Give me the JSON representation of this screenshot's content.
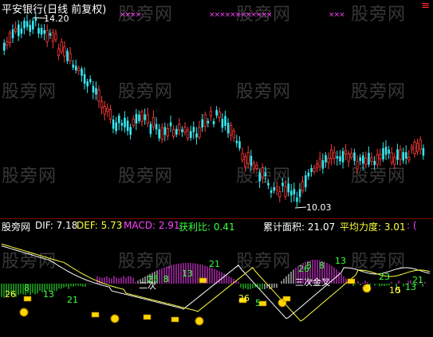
{
  "header": {
    "title": "平安银行(日线 前复权)",
    "top_right_mark": "≡",
    "top_marks_1": "××××",
    "top_marks_2": "××××××××××××",
    "top_marks_3": "×××"
  },
  "price_panel": {
    "high_label": "14.20",
    "low_label": "10.03",
    "colors": {
      "up": "#ff3a3a",
      "down": "#35e8f0"
    }
  },
  "indicator_bar": {
    "name": "股旁网",
    "dif_label": "DIF: 7.18",
    "def_label": "DEF: 5.73",
    "macd_label": "MACD: 2.91",
    "profit_label": "获利比: 0.41",
    "area_label": "累计面积: 21.07",
    "force_label": "平均力度: 3.01",
    "tail": ": ("
  },
  "sub_panel": {
    "labels": {
      "l_26a": "26",
      "l_8a": "8",
      "l_13a": "13",
      "l_21a": "21",
      "l_2q": "二次",
      "l_25": "25",
      "l_8b": "8",
      "l_13b": "13",
      "l_21b": "21",
      "l_26b": "26",
      "l_5": "5",
      "l_26c": "26",
      "l_5c": "5",
      "l_8c": "8",
      "l_13c": "13",
      "l_kiss": "三次金叉",
      "l_3": "3",
      "l_10": "10",
      "l_13d": "13",
      "l_23": "23",
      "l_5d": "5",
      "l_21c": "21"
    }
  },
  "watermarks": {
    "text": "股旁网"
  }
}
